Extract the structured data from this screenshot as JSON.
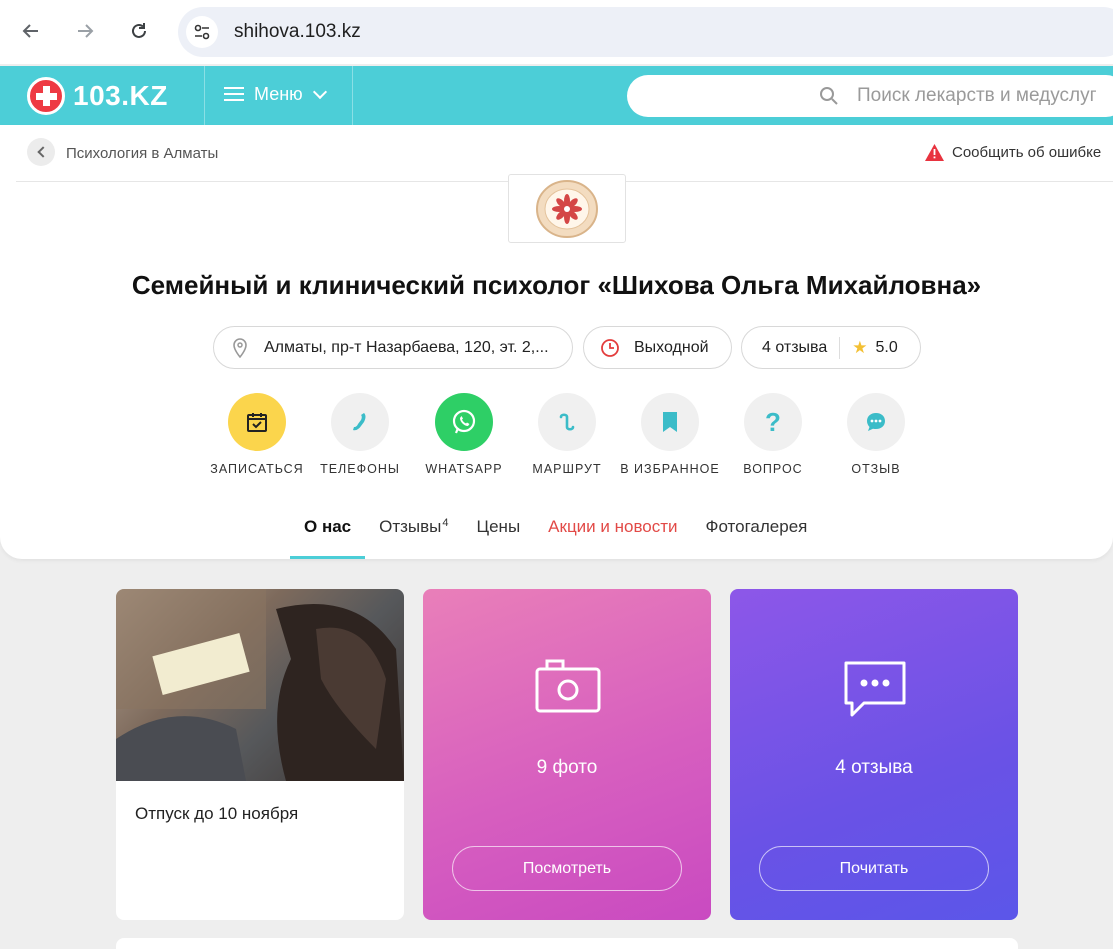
{
  "browser": {
    "url": "shihova.103.kz",
    "back_icon": "arrow-left-icon",
    "forward_icon": "arrow-right-icon",
    "reload_icon": "reload-icon"
  },
  "header": {
    "logo_text": "103.KZ",
    "menu_label": "Меню",
    "search_placeholder": "Поиск лекарств и медуслуг",
    "accent_color": "#4cced7"
  },
  "breadcrumb": {
    "label": "Психология в Алматы"
  },
  "report_error": "Сообщить об ошибке",
  "clinic": {
    "title": "Семейный и клинический психолог «Шихова Ольга Михайловна»",
    "address": "Алматы, пр-т Назарбаева, 120, эт. 2,...",
    "hours": "Выходной",
    "reviews_count": "4 отзыва",
    "rating": "5.0"
  },
  "actions": [
    {
      "label": "ЗАПИСАТЬСЯ",
      "icon": "calendar-check-icon",
      "color": "#fbd54c"
    },
    {
      "label": "ТЕЛЕФОНЫ",
      "icon": "phone-icon",
      "color": "#f0f0f0"
    },
    {
      "label": "WHATSAPP",
      "icon": "whatsapp-icon",
      "color": "#2ecf66"
    },
    {
      "label": "МАРШРУТ",
      "icon": "route-icon",
      "color": "#f0f0f0"
    },
    {
      "label": "В ИЗБРАННОЕ",
      "icon": "bookmark-icon",
      "color": "#f0f0f0"
    },
    {
      "label": "ВОПРОС",
      "icon": "question-icon",
      "color": "#f0f0f0"
    },
    {
      "label": "ОТЗЫВ",
      "icon": "chat-bubble-icon",
      "color": "#f0f0f0"
    }
  ],
  "tabs": [
    {
      "label": "О нас"
    },
    {
      "label": "Отзывы",
      "badge": "4"
    },
    {
      "label": "Цены"
    },
    {
      "label": "Акции и новости"
    },
    {
      "label": "Фотогалерея"
    }
  ],
  "cards": {
    "note": "Отпуск до 10 ноября",
    "photos_count": "9 фото",
    "photos_button": "Посмотреть",
    "reviews_count": "4 отзыва",
    "reviews_button": "Почитать"
  }
}
